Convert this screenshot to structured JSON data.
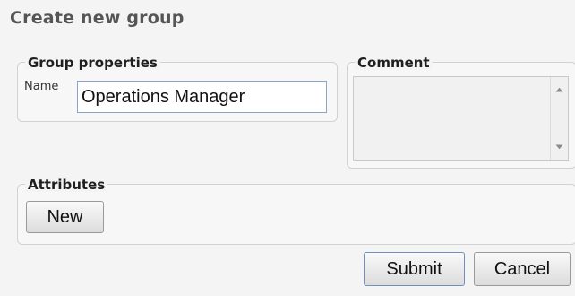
{
  "dialog": {
    "title": "Create new group"
  },
  "group_properties": {
    "legend": "Group properties",
    "name_label": "Name",
    "name_value": "Operations Manager"
  },
  "comment": {
    "legend": "Comment",
    "value": ""
  },
  "attributes": {
    "legend": "Attributes",
    "new_label": "New"
  },
  "actions": {
    "submit_label": "Submit",
    "cancel_label": "Cancel"
  },
  "icons": {
    "scroll_up": "scroll-up-arrow-icon",
    "scroll_down": "scroll-down-arrow-icon"
  }
}
